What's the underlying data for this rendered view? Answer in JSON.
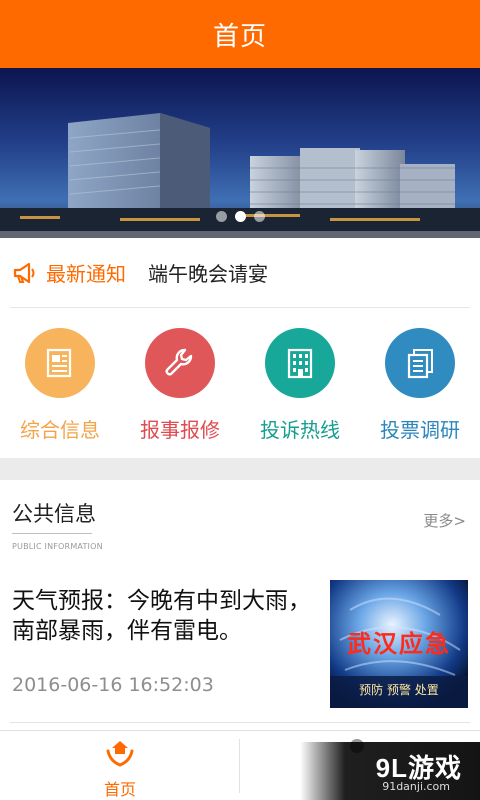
{
  "header": {
    "title": "首页"
  },
  "banner": {
    "slides": 3,
    "active_slide": 1
  },
  "notice": {
    "label": "最新通知",
    "text": "端午晚会请宴",
    "icon": "megaphone-icon"
  },
  "quick_actions": [
    {
      "label": "综合信息",
      "icon": "newspaper-icon",
      "color": "#f7b45c",
      "label_color": "#f3a44a"
    },
    {
      "label": "报事报修",
      "icon": "wrench-icon",
      "color": "#e0575a",
      "label_color": "#df4b50"
    },
    {
      "label": "投诉热线",
      "icon": "building-icon",
      "color": "#17a89a",
      "label_color": "#169e8f"
    },
    {
      "label": "投票调研",
      "icon": "documents-icon",
      "color": "#2f8bc0",
      "label_color": "#2a86bb"
    }
  ],
  "section": {
    "title": "公共信息",
    "subtitle": "PUBLIC INFORMATION",
    "more": "更多>"
  },
  "article": {
    "title": "天气预报：今晚有中到大雨，南部暴雨，伴有雷电。",
    "date": "2016-06-16 16:52:03",
    "thumb_title": "武汉应急",
    "thumb_sub": "预防  预警  处置"
  },
  "tabs": [
    {
      "label": "首页",
      "icon": "home-hands-icon",
      "active": true
    },
    {
      "label": "",
      "icon": "profile-icon",
      "active": false
    }
  ],
  "watermark": {
    "logo": "9L游戏",
    "url": "91danji.com"
  },
  "colors": {
    "accent": "#ff6a00"
  }
}
